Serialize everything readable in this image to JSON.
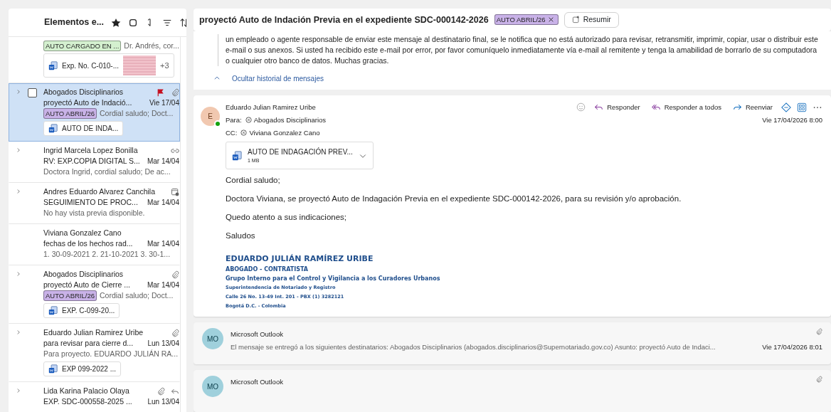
{
  "list": {
    "title": "Elementos e...",
    "items": [
      {
        "selected": false,
        "tag": {
          "label": "AUTO CARGADO EN ...",
          "color": "#d4f0cf"
        },
        "preview": "Dr. Andrés, cor...",
        "attachments": [
          {
            "name": "Exp. No. C-010-..."
          }
        ],
        "thumbnail": true,
        "more": "+3"
      },
      {
        "sender": "Abogados Disciplinarios",
        "subject": "proyectó Auto de Indació...",
        "date": "Vie 17/04",
        "expandable": true,
        "selected": true,
        "checked": false,
        "flagged": true,
        "has_attachment": true,
        "tag": {
          "label": "AUTO ABRIL/26",
          "color": "#c9b2e8"
        },
        "preview": "Cordial saludo; Doct...",
        "attachments": [
          {
            "name": "AUTO DE INDA..."
          }
        ]
      },
      {
        "sender": "Ingrid Marcela Lopez Bonilla",
        "subject": "RV: EXP.COPIA DIGITAL S...",
        "date": "Mar 14/04",
        "expandable": true,
        "selected": false,
        "has_link": true,
        "preview": "Doctora Ingrid, cordial saludo; De ac..."
      },
      {
        "sender": "Andres Eduardo Alvarez Canchila",
        "subject": "SEGUIMIENTO DE PROC...",
        "date": "Mar 14/04",
        "expandable": true,
        "selected": false,
        "is_meeting": true,
        "preview": "No hay vista previa disponible."
      },
      {
        "sender": "Viviana Gonzalez Cano",
        "subject": "fechas de los hechos rad...",
        "date": "Mar 14/04",
        "expandable": false,
        "selected": false,
        "preview": "1. 30-09-2021 2. 21-10-2021 3. 30-1..."
      },
      {
        "sender": "Abogados Disciplinarios",
        "subject": "proyectó Auto de Cierre ...",
        "date": "Mar 14/04",
        "expandable": true,
        "selected": false,
        "has_attachment": true,
        "tag": {
          "label": "AUTO ABRIL/26",
          "color": "#c9b2e8"
        },
        "preview": "Cordial saludo; Doct...",
        "attachments": [
          {
            "name": "EXP. C-099-20..."
          }
        ]
      },
      {
        "sender": "Eduardo Julian Ramirez Uribe",
        "subject": "para revisar para cierre d...",
        "date": "Lun 13/04",
        "expandable": true,
        "selected": false,
        "has_attachment": true,
        "preview": "Para proyecto. EDUARDO JULIÁN RA...",
        "attachments": [
          {
            "name": "EXP 099-2022 ..."
          }
        ]
      },
      {
        "sender": "Lida Karina Palacio Olaya",
        "subject": "EXP. SDC-000558-2025 ...",
        "date": "Lun 13/04",
        "expandable": true,
        "selected": false,
        "has_attachment": true,
        "replied": true
      }
    ]
  },
  "reading": {
    "subject": "proyectó Auto de Indación Previa en el expediente SDC-000142-2026",
    "tag": {
      "label": "AUTO ABRIL/26",
      "color": "#c9b2e8"
    },
    "summarize_button": "Resumir",
    "disclaimer": "un empleado o agente responsable de enviar este mensaje al destinatario final, se le notifica que no está autorizado para revisar, retransmitir, imprimir, copiar, usar o distribuir este e-mail o sus anexos. Si usted ha recibido este e-mail por error, por favor comuníquelo inmediatamente vía e-mail al remitente y tenga la amabilidad de borrarlo de su computadora o cualquier otro banco de datos. Muchas gracias.",
    "history_toggle": "Ocultar historial de mensajes",
    "message": {
      "avatar": "E",
      "online": true,
      "sender": "Eduardo Julian Ramirez Uribe",
      "to_label": "Para:",
      "to": "Abogados Disciplinarios",
      "cc_label": "CC:",
      "cc": "Viviana Gonzalez Cano",
      "actions": [
        {
          "label": "Responder",
          "kind": "reply"
        },
        {
          "label": "Responder a todos",
          "kind": "reply-all"
        },
        {
          "label": "Reenviar",
          "kind": "forward"
        }
      ],
      "date": "Vie 17/04/2026 8:00",
      "attachment": {
        "name": "AUTO DE INDAGACIÓN PREV...",
        "size": "1 MB"
      },
      "body": [
        "Cordial saludo;",
        "Doctora Viviana, se proyectó Auto de Indagación Previa en el expediente SDC-000142-2026, para su revisión y/o aprobación.",
        "Quedo atento a sus indicaciones;",
        "Saludos"
      ],
      "signature": [
        {
          "text": "EDUARDO JULIÁN RAMÍREZ URIBE",
          "kind": "name"
        },
        {
          "text": "ABOGADO - CONTRATISTA",
          "kind": "role"
        },
        {
          "text": "Grupo Interno para el Control y Vigilancia a los Curadores Urbanos",
          "kind": "group"
        },
        {
          "text": "Superintendencia de Notariado y Registro",
          "kind": "small"
        },
        {
          "text": "Calle 26 No. 13-49 Int. 201 - PBX (1) 3282121",
          "kind": "small"
        },
        {
          "text": "Bogotá D.C. - Colombia",
          "kind": "small"
        }
      ]
    },
    "collapsed": [
      {
        "avatar": "MO",
        "sender": "Microsoft Outlook",
        "preview": "El mensaje se entregó a los siguientes destinatarios: Abogados Disciplinarios (abogados.disciplinarios@Supernotariado.gov.co) Asunto: proyectó Auto de Indaci...",
        "date": "Vie 17/04/2026 8:01",
        "has_attachment": true
      },
      {
        "avatar": "MO",
        "sender": "Microsoft Outlook",
        "has_attachment": true
      }
    ]
  }
}
